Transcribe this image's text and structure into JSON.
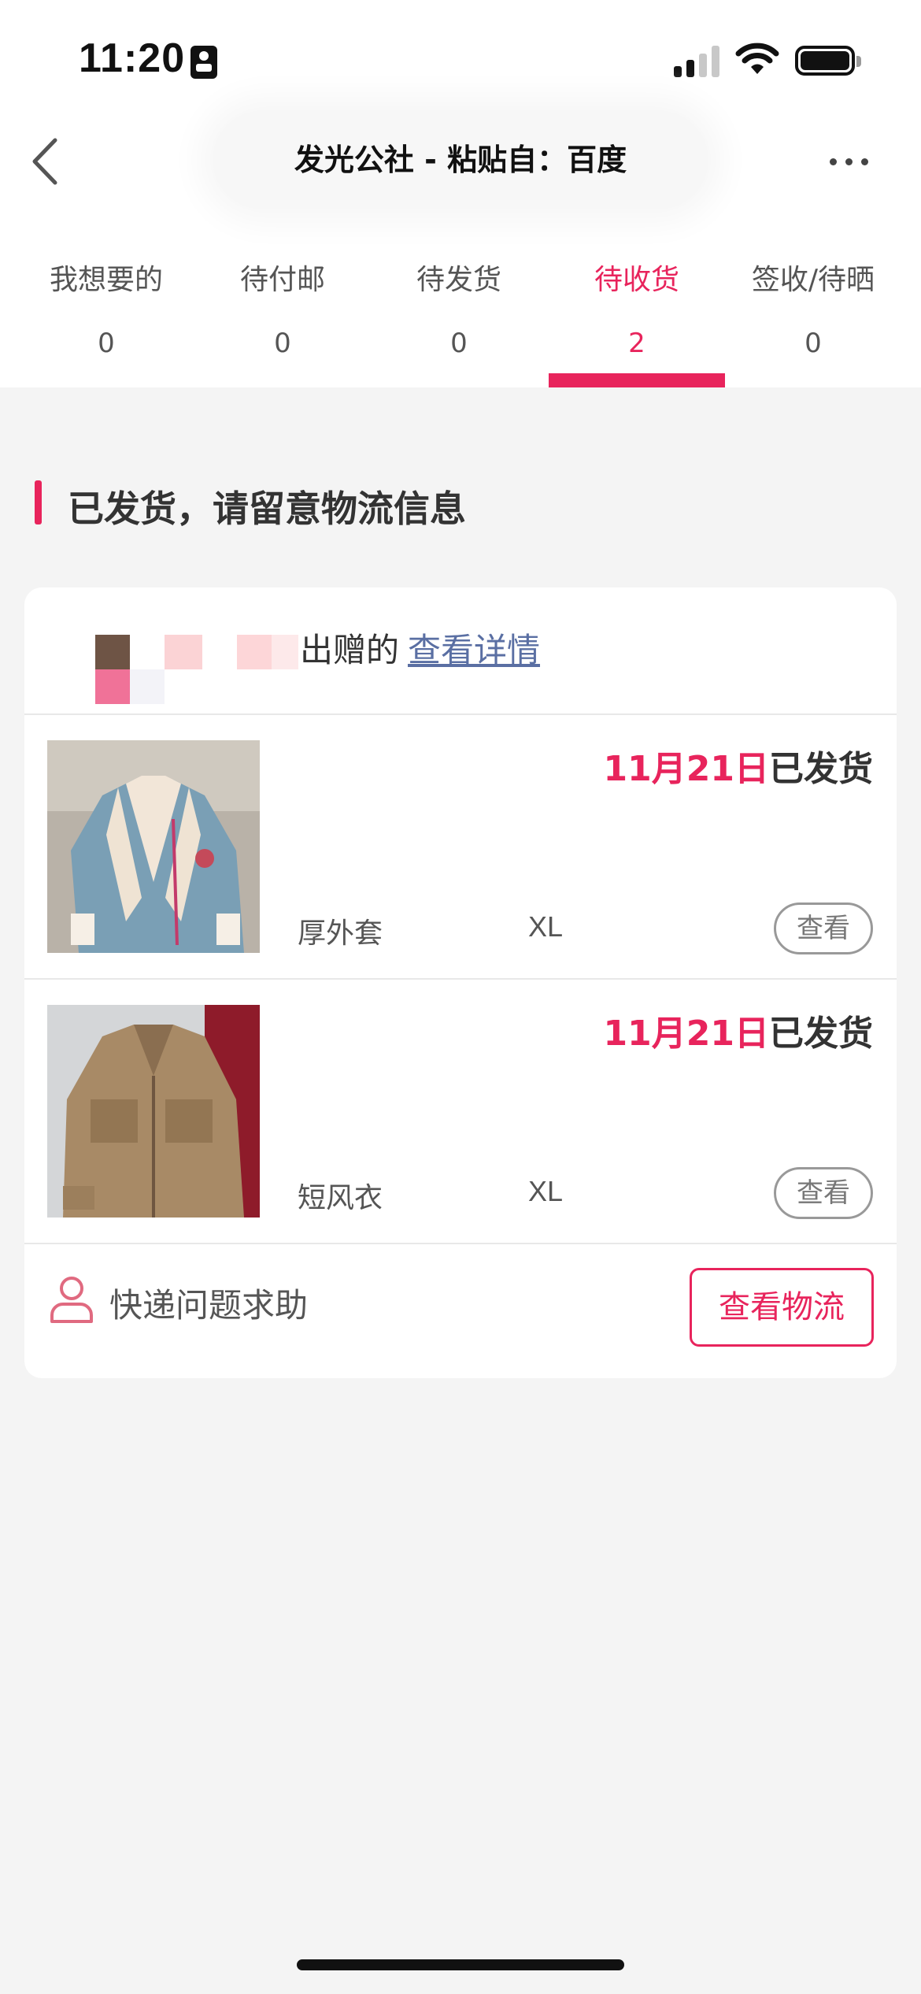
{
  "status_bar": {
    "time": "11:20"
  },
  "nav": {
    "title": "发光公社 - 粘贴自：百度",
    "back_icon": "chevron-left-icon",
    "more_icon": "more-dots-icon"
  },
  "tabs": [
    {
      "label": "我想要的",
      "count": "0",
      "active": false
    },
    {
      "label": "待付邮",
      "count": "0",
      "active": false
    },
    {
      "label": "待发货",
      "count": "0",
      "active": false
    },
    {
      "label": "待收货",
      "count": "2",
      "active": true
    },
    {
      "label": "签收/待晒",
      "count": "0",
      "active": false
    }
  ],
  "section": {
    "heading": "已发货，请留意物流信息"
  },
  "order": {
    "sender_suffix": "出赠的",
    "detail_link": "查看详情",
    "items": [
      {
        "date": "11月21日",
        "status": "已发货",
        "name": "厚外套",
        "size": "XL",
        "view_label": "查看"
      },
      {
        "date": "11月21日",
        "status": "已发货",
        "name": "短风衣",
        "size": "XL",
        "view_label": "查看"
      }
    ],
    "help_label": "快递问题求助",
    "logistics_button": "查看物流"
  },
  "colors": {
    "accent": "#e8245c",
    "link": "#5a6fa3",
    "background": "#f4f4f4"
  }
}
